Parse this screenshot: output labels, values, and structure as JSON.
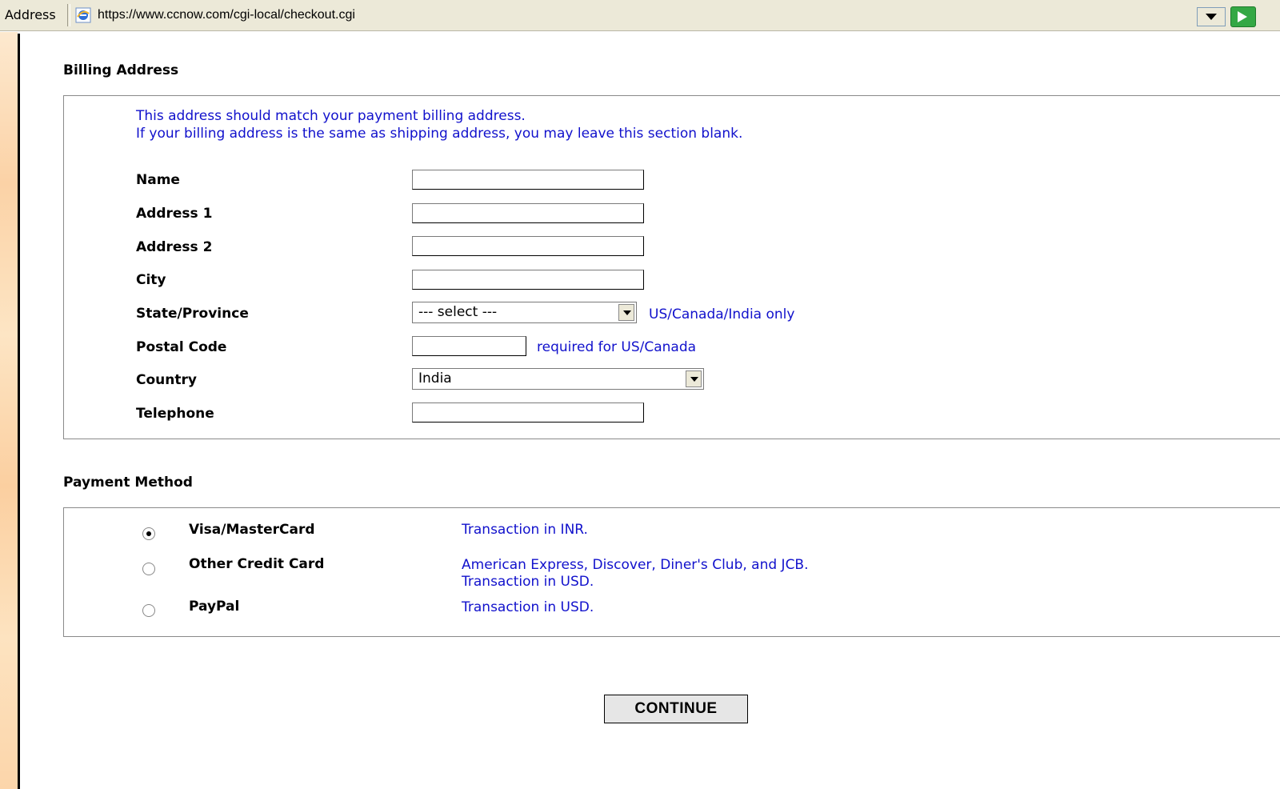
{
  "browser": {
    "address_label": "Address",
    "url": "https://www.ccnow.com/cgi-local/checkout.cgi"
  },
  "billing": {
    "heading": "Billing Address",
    "intro_line1": "This address should match your payment billing address.",
    "intro_line2": "If your billing address is the same as shipping address, you may leave this section blank.",
    "fields": {
      "name": {
        "label": "Name",
        "value": ""
      },
      "address1": {
        "label": "Address 1",
        "value": ""
      },
      "address2": {
        "label": "Address 2",
        "value": ""
      },
      "city": {
        "label": "City",
        "value": ""
      },
      "state": {
        "label": "State/Province",
        "value": "--- select ---",
        "hint": "US/Canada/India only"
      },
      "postal": {
        "label": "Postal Code",
        "value": "",
        "hint": "required for US/Canada"
      },
      "country": {
        "label": "Country",
        "value": "India"
      },
      "telephone": {
        "label": "Telephone",
        "value": ""
      }
    }
  },
  "payment": {
    "heading": "Payment Method",
    "methods": [
      {
        "label": "Visa/MasterCard",
        "desc_line1": "Transaction in INR.",
        "desc_line2": "",
        "selected": true
      },
      {
        "label": "Other Credit Card",
        "desc_line1": "American Express, Discover, Diner's Club, and JCB.",
        "desc_line2": "Transaction in USD.",
        "selected": false
      },
      {
        "label": "PayPal",
        "desc_line1": "Transaction in USD.",
        "desc_line2": "",
        "selected": false
      }
    ]
  },
  "actions": {
    "continue_label": "CONTINUE"
  },
  "icons": {
    "ie_page": "ie-page-icon",
    "address_dropdown": "chevron-down-icon",
    "go": "go-arrow-icon"
  },
  "colors": {
    "link_blue": "#1111cc",
    "chrome_bg": "#ece9d8",
    "go_green": "#34a844"
  }
}
